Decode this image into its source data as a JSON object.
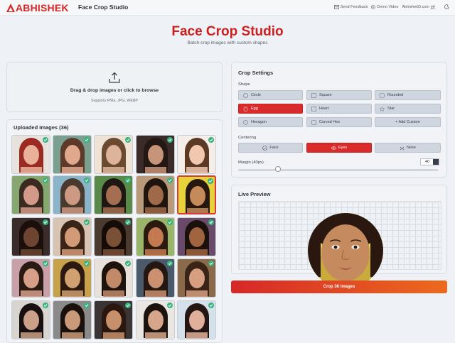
{
  "brand": {
    "logo_text": "ABHISHEK",
    "app_name": "Face Crop Studio",
    "color": "#d62828"
  },
  "nav": {
    "send_feedback": "Send Feedback",
    "demo_video": "Demo Video",
    "site": "AbhishekD.com"
  },
  "hero": {
    "title": "Face Crop Studio",
    "subtitle": "Batch-crop images with custom shapes"
  },
  "dropzone": {
    "title": "Drag & drop images or click to browse",
    "formats": "Supports PNG, JPG, WEBP"
  },
  "uploaded": {
    "title": "Uploaded Images (36)",
    "thumbs": [
      {
        "c1": "#9a2a22",
        "c2": "#e9b19a",
        "bg": "#e8e2dc"
      },
      {
        "c1": "#5e3a2a",
        "c2": "#e0a98d",
        "bg": "#7ca090"
      },
      {
        "c1": "#6a4a30",
        "c2": "#ddb49a",
        "bg": "#efe3d6"
      },
      {
        "c1": "#241815",
        "c2": "#c69478",
        "bg": "#3a2b28"
      },
      {
        "c1": "#5a3a25",
        "c2": "#f1c7b0",
        "bg": "#f4ede8"
      },
      {
        "c1": "#3a2a20",
        "c2": "#d39a8a",
        "bg": "#86a870"
      },
      {
        "c1": "#4a3a2e",
        "c2": "#cc9a82",
        "bg": "#8cb4c8"
      },
      {
        "c1": "#1f1713",
        "c2": "#a36f50",
        "bg": "#5a8a4a"
      },
      {
        "c1": "#20140f",
        "c2": "#9e6a4a",
        "bg": "#b89a7a"
      },
      {
        "c1": "#26170f",
        "c2": "#c58a5a",
        "bg": "#e8d23a"
      },
      {
        "c1": "#1a0f0a",
        "c2": "#6c4430",
        "bg": "#3a2c2a"
      },
      {
        "c1": "#3a2418",
        "c2": "#d39a78",
        "bg": "#d9c4b4"
      },
      {
        "c1": "#150c08",
        "c2": "#7a5036",
        "bg": "#4a3a30"
      },
      {
        "c1": "#2a1a10",
        "c2": "#c47a50",
        "bg": "#9ab46a"
      },
      {
        "c1": "#1a100c",
        "c2": "#a06440",
        "bg": "#6a4a6a"
      },
      {
        "c1": "#2a1a14",
        "c2": "#d6a088",
        "bg": "#c9a0a8"
      },
      {
        "c1": "#2c1a10",
        "c2": "#d0a070",
        "bg": "#c8a24a"
      },
      {
        "c1": "#1e120c",
        "c2": "#c28a68",
        "bg": "#e8e0da"
      },
      {
        "c1": "#241610",
        "c2": "#ca9070",
        "bg": "#4a5a6a"
      },
      {
        "c1": "#3a2418",
        "c2": "#d6a080",
        "bg": "#8a6a4a"
      },
      {
        "c1": "#181010",
        "c2": "#caa088",
        "bg": "#d8d4d0"
      },
      {
        "c1": "#1a100c",
        "c2": "#c89a7a",
        "bg": "#8a8a8a"
      },
      {
        "c1": "#2a1810",
        "c2": "#c8906a",
        "bg": "#3a3434"
      },
      {
        "c1": "#1c120e",
        "c2": "#d6a68a",
        "bg": "#eae6e2"
      },
      {
        "c1": "#241612",
        "c2": "#e0b09a",
        "bg": "#d4e0ea"
      }
    ]
  },
  "settings": {
    "title": "Crop Settings",
    "shape_label": "Shape",
    "shapes": [
      "Circle",
      "Square",
      "Rounded",
      "Egg",
      "Heart",
      "Star",
      "Hexagon",
      "Curved Hex",
      "+ Add Custom"
    ],
    "centering_label": "Centering",
    "centering": [
      "Face",
      "Eyes",
      "Nose"
    ],
    "margin_label": "Margin (40px)",
    "margin_value": "40",
    "margin_level": 0.2
  },
  "preview": {
    "title": "Live Preview"
  },
  "crop_button": "Crop 36 Images"
}
